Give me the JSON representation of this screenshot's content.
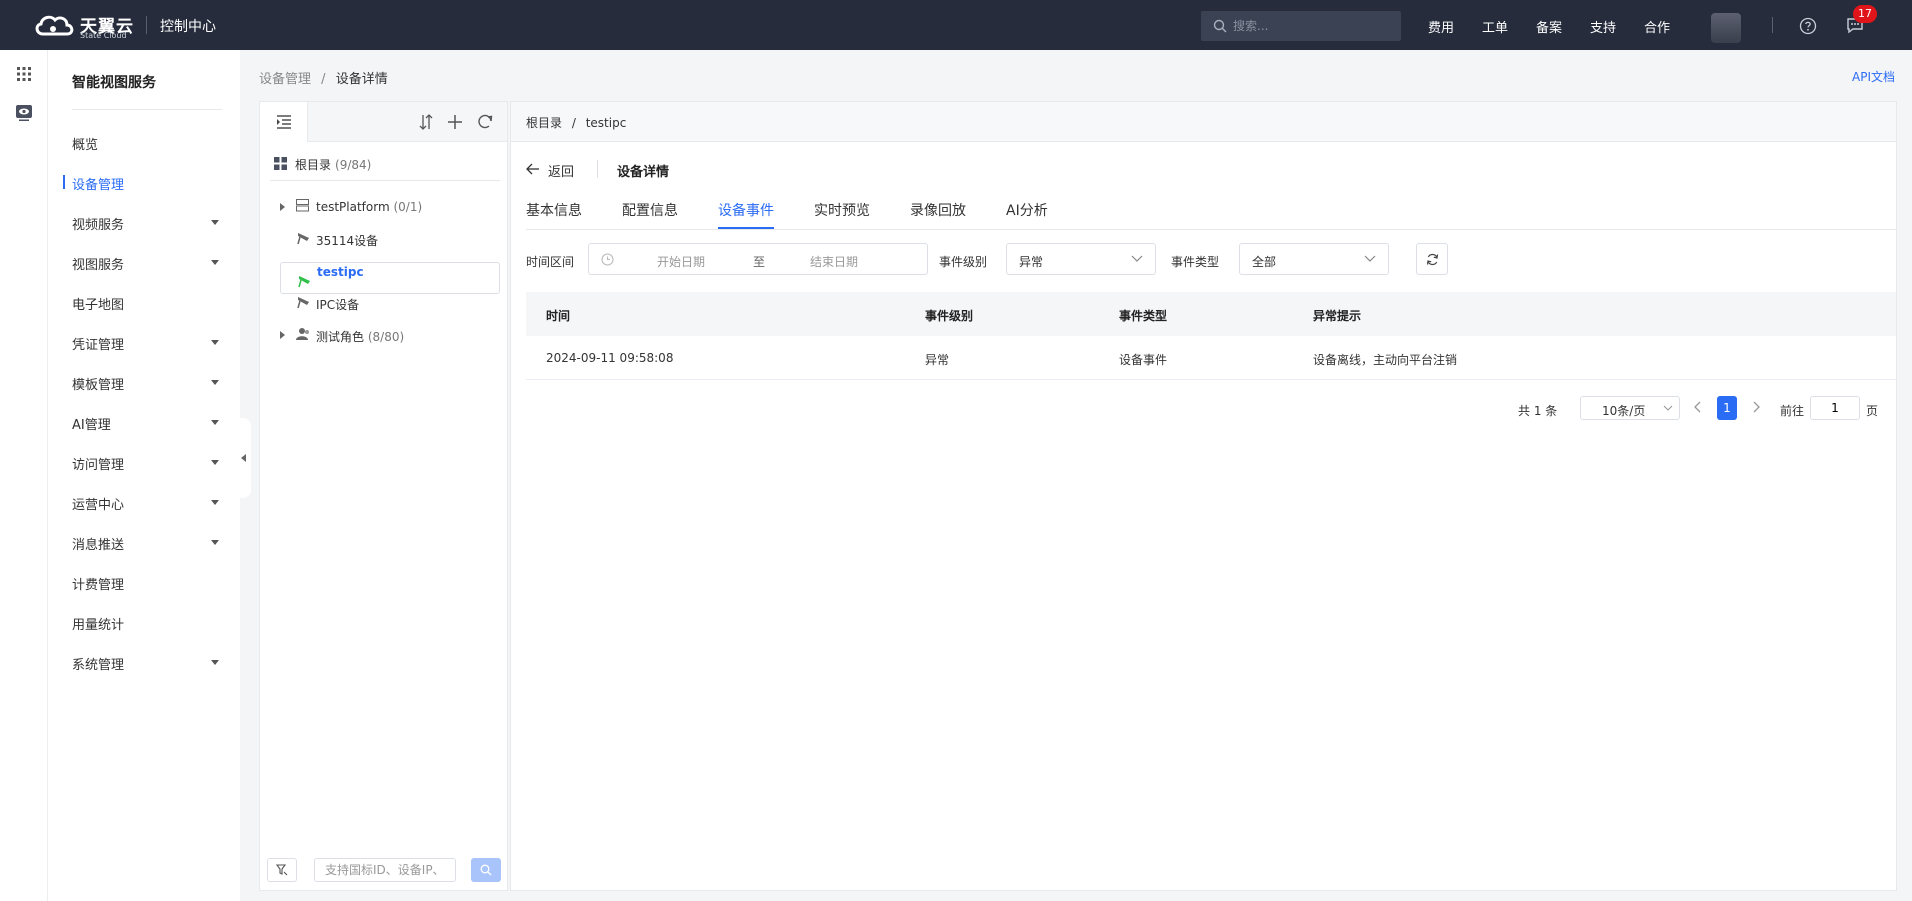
{
  "topbar": {
    "logo_cn": "天翼云",
    "logo_en": "State Cloud",
    "console_title": "控制中心",
    "search_placeholder": "搜索...",
    "nav": [
      "费用",
      "工单",
      "备案",
      "支持",
      "合作"
    ],
    "badge_count": "17"
  },
  "sidebar": {
    "title": "智能视图服务",
    "items": [
      {
        "label": "概览",
        "expandable": false
      },
      {
        "label": "设备管理",
        "expandable": false,
        "active": true
      },
      {
        "label": "视频服务",
        "expandable": true
      },
      {
        "label": "视图服务",
        "expandable": true
      },
      {
        "label": "电子地图",
        "expandable": false
      },
      {
        "label": "凭证管理",
        "expandable": true
      },
      {
        "label": "模板管理",
        "expandable": true
      },
      {
        "label": "AI管理",
        "expandable": true
      },
      {
        "label": "访问管理",
        "expandable": true
      },
      {
        "label": "运营中心",
        "expandable": true
      },
      {
        "label": "消息推送",
        "expandable": true
      },
      {
        "label": "计费管理",
        "expandable": false
      },
      {
        "label": "用量统计",
        "expandable": false
      },
      {
        "label": "系统管理",
        "expandable": true
      }
    ]
  },
  "breadcrumb": {
    "parent": "设备管理",
    "separator": "/",
    "current": "设备详情"
  },
  "api_doc": "API文档",
  "tree": {
    "root_label": "根目录",
    "root_count": "(9/84)",
    "nodes": [
      {
        "label": "testPlatform",
        "count": "(0/1)"
      },
      {
        "label": "35114设备",
        "count": ""
      },
      {
        "label": "testipc",
        "count": ""
      },
      {
        "label": "IPC设备",
        "count": ""
      },
      {
        "label": "测试角色",
        "count": "(8/80)"
      }
    ],
    "search_placeholder": "支持国标ID、设备IP、"
  },
  "main": {
    "crumb_root": "根目录",
    "crumb_sep": "/",
    "crumb_current": "testipc",
    "back_label": "返回",
    "title": "设备详情",
    "tabs": [
      "基本信息",
      "配置信息",
      "设备事件",
      "实时预览",
      "录像回放",
      "AI分析"
    ],
    "active_tab": "设备事件"
  },
  "filters": {
    "time_label": "时间区间",
    "start_placeholder": "开始日期",
    "range_sep": "至",
    "end_placeholder": "结束日期",
    "level_label": "事件级别",
    "level_value": "异常",
    "type_label": "事件类型",
    "type_value": "全部"
  },
  "table": {
    "columns": [
      "时间",
      "事件级别",
      "事件类型",
      "异常提示"
    ],
    "rows": [
      [
        "2024-09-11 09:58:08",
        "异常",
        "设备事件",
        "设备离线，主动向平台注销"
      ]
    ]
  },
  "pagination": {
    "total": "共 1 条",
    "page_size": "10条/页",
    "current_page": "1",
    "goto_label": "前往",
    "goto_value": "1",
    "goto_suffix": "页"
  },
  "colors": {
    "accent": "#2b6cf5",
    "topbar": "#262c3c",
    "badge": "#e0151a",
    "online": "#2fbf4a"
  }
}
